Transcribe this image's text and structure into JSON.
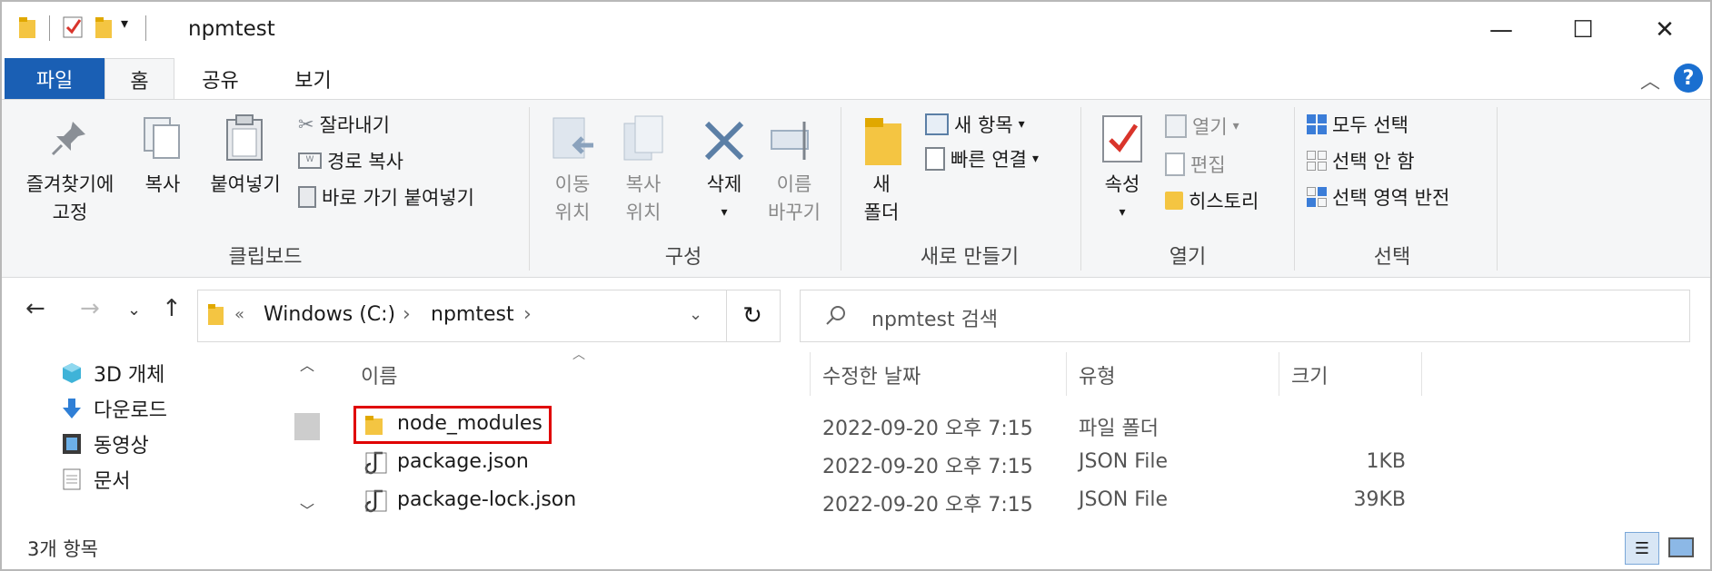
{
  "window": {
    "title": "npmtest"
  },
  "ribbon_tabs": [
    "파일",
    "홈",
    "공유",
    "보기"
  ],
  "ribbon": {
    "clipboard": {
      "pin": "즐겨찾기에\n고정",
      "copy": "복사",
      "paste": "붙여넣기",
      "cut": "잘라내기",
      "copy_path": "경로 복사",
      "paste_shortcut": "바로 가기 붙여넣기",
      "label": "클립보드"
    },
    "organize": {
      "move_to": "이동\n위치",
      "copy_to": "복사\n위치",
      "delete": "삭제",
      "rename": "이름\n바꾸기",
      "label": "구성"
    },
    "new": {
      "new_folder": "새\n폴더",
      "new_item": "새 항목",
      "easy_access": "빠른 연결",
      "label": "새로 만들기"
    },
    "open": {
      "properties": "속성",
      "open": "열기",
      "edit": "편집",
      "history": "히스토리",
      "label": "열기"
    },
    "select": {
      "select_all": "모두 선택",
      "select_none": "선택 안 함",
      "invert": "선택 영역 반전",
      "label": "선택"
    }
  },
  "address": {
    "breadcrumbs": [
      "Windows (C:)",
      "npmtest"
    ],
    "search_placeholder": "npmtest 검색"
  },
  "nav_pane": {
    "items": [
      {
        "label": "3D 개체",
        "icon": "cube-icon"
      },
      {
        "label": "다운로드",
        "icon": "download-arrow-icon"
      },
      {
        "label": "동영상",
        "icon": "film-icon"
      },
      {
        "label": "문서",
        "icon": "document-icon"
      }
    ]
  },
  "columns": [
    "이름",
    "수정한 날짜",
    "유형",
    "크기"
  ],
  "files": [
    {
      "name": "node_modules",
      "date": "2022-09-20 오후 7:15",
      "type": "파일 폴더",
      "size": "",
      "icon": "folder-icon",
      "highlighted": true
    },
    {
      "name": "package.json",
      "date": "2022-09-20 오후 7:15",
      "type": "JSON File",
      "size": "1KB",
      "icon": "json-file-icon",
      "highlighted": false
    },
    {
      "name": "package-lock.json",
      "date": "2022-09-20 오후 7:15",
      "type": "JSON File",
      "size": "39KB",
      "icon": "json-file-icon",
      "highlighted": false
    }
  ],
  "status": {
    "item_count": "3개 항목"
  },
  "colors": {
    "file_tab": "#1a5fb4",
    "highlight_box": "#e00000",
    "folder": "#f4c542"
  }
}
